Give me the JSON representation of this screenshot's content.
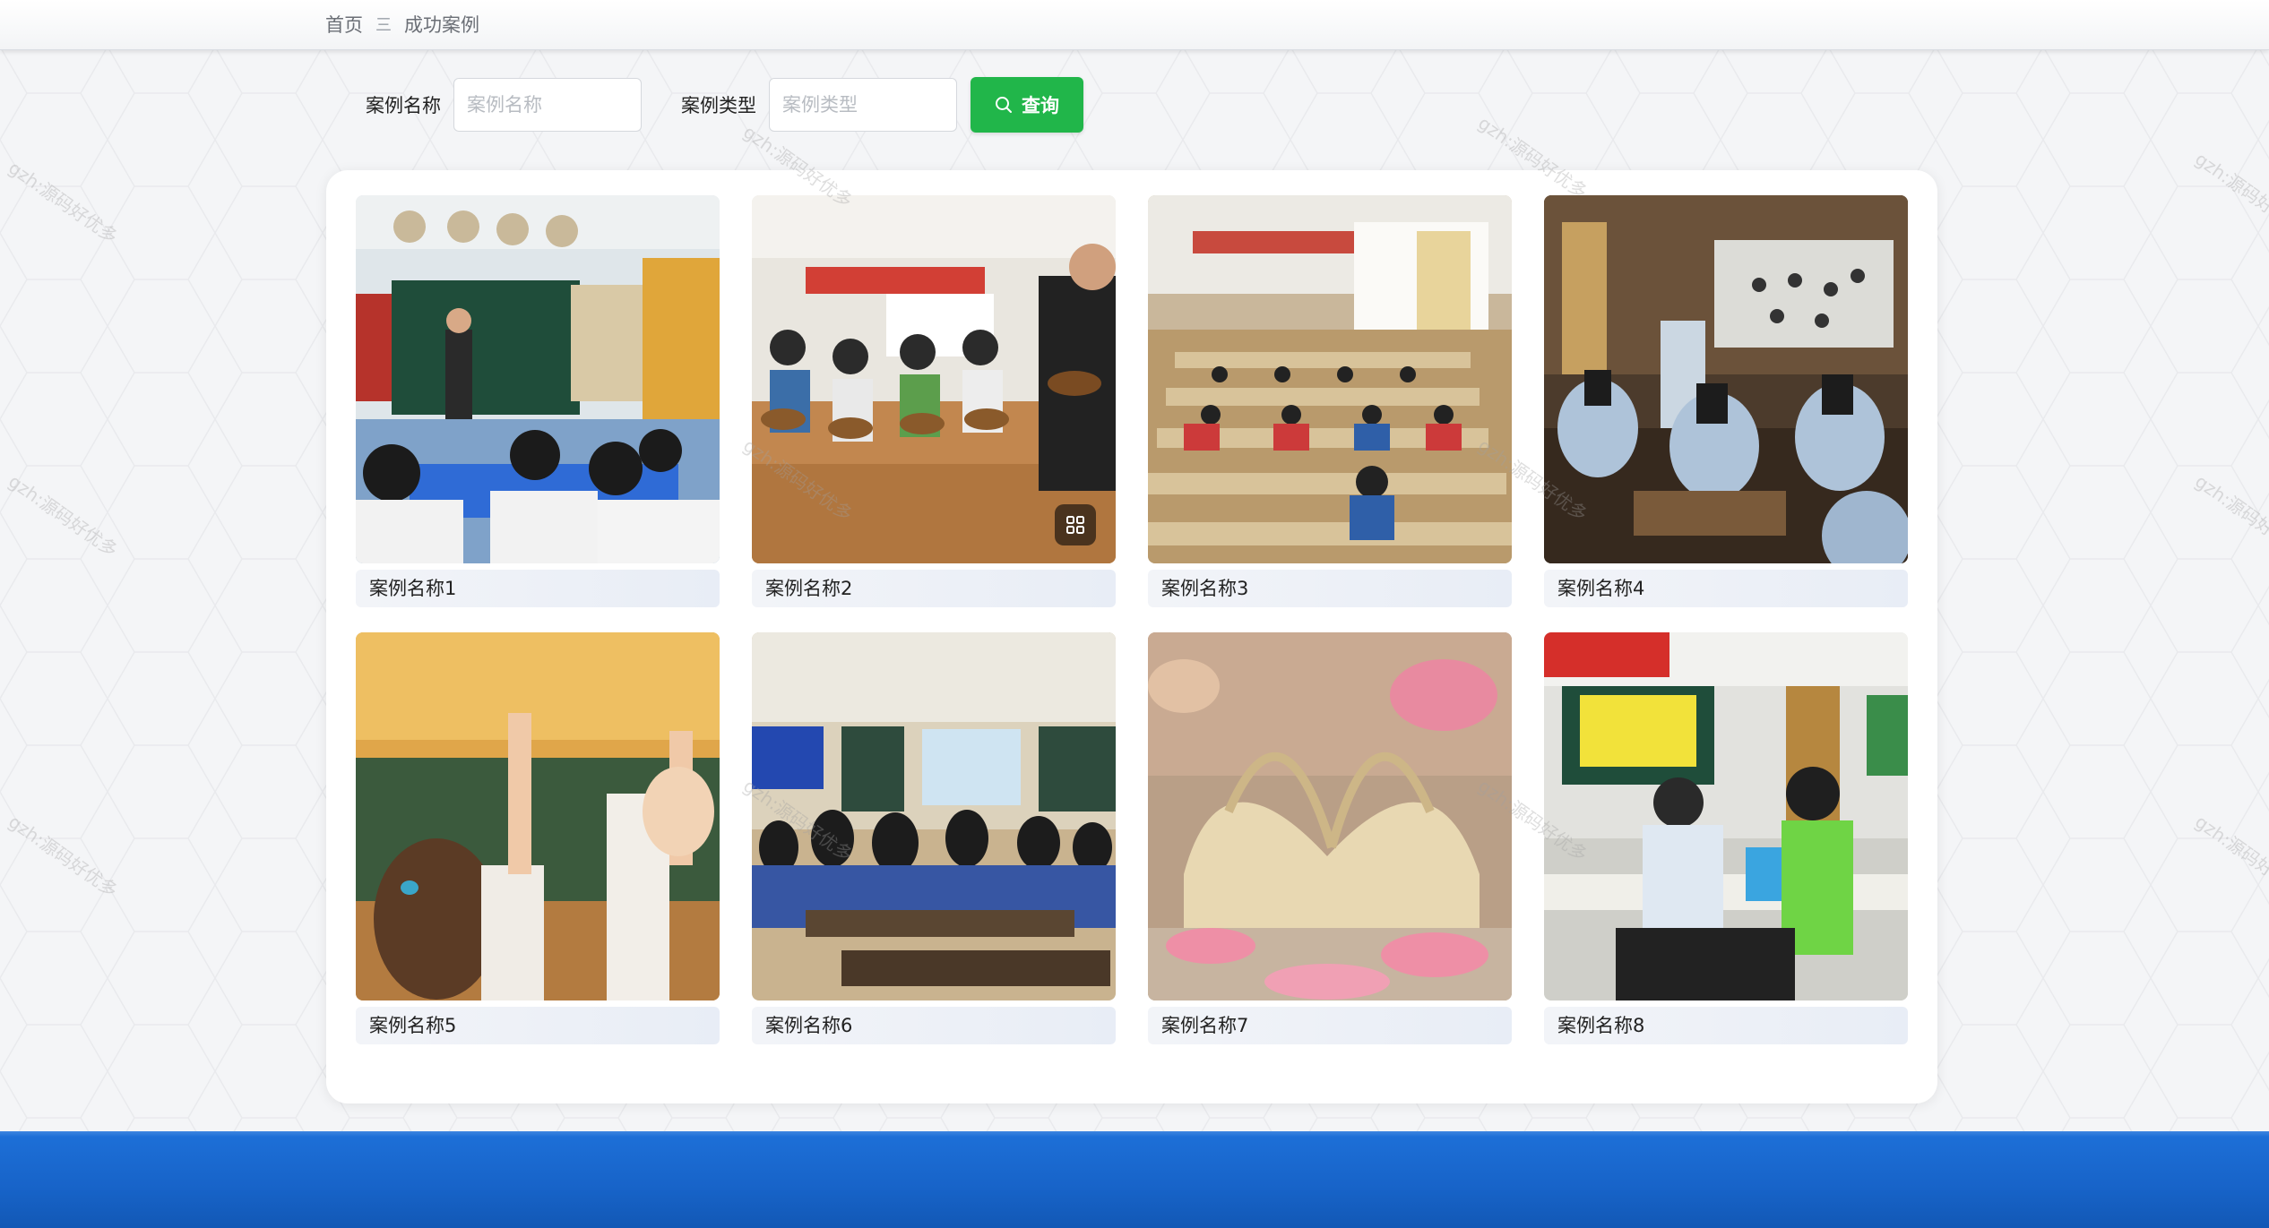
{
  "breadcrumb": {
    "home": "首页",
    "separator": "三",
    "current": "成功案例"
  },
  "search": {
    "name_label": "案例名称",
    "name_placeholder": "案例名称",
    "type_label": "案例类型",
    "type_placeholder": "案例类型",
    "query_label": "查询",
    "query_icon": "search-icon"
  },
  "cases": [
    {
      "name": "案例名称1"
    },
    {
      "name": "案例名称2"
    },
    {
      "name": "案例名称3"
    },
    {
      "name": "案例名称4"
    },
    {
      "name": "案例名称5"
    },
    {
      "name": "案例名称6"
    },
    {
      "name": "案例名称7"
    },
    {
      "name": "案例名称8"
    }
  ],
  "watermark": "gzh:源码好优多",
  "colors": {
    "accent": "#21b64a",
    "footer": "#1763c8"
  }
}
